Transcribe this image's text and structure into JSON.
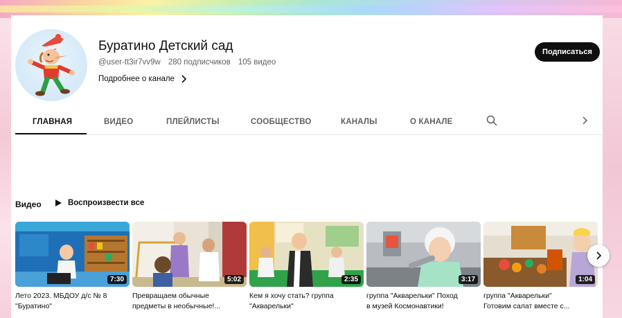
{
  "channel": {
    "name": "Буратино Детский сад",
    "handle": "@user-tt3ir7vv9w",
    "subscribers": "280 подписчиков",
    "videos_count": "105 видео",
    "more_link": "Подробнее о канале",
    "subscribe_label": "Подписаться"
  },
  "tabs": [
    {
      "label": "ГЛАВНАЯ"
    },
    {
      "label": "ВИДЕО"
    },
    {
      "label": "ПЛЕЙЛИСТЫ"
    },
    {
      "label": "СООБЩЕСТВО"
    },
    {
      "label": "КАНАЛЫ"
    },
    {
      "label": "О КАНАЛЕ"
    }
  ],
  "section": {
    "title": "Видео",
    "play_all": "Воспроизвести все"
  },
  "videos": [
    {
      "duration": "7:30",
      "title_line1": "Лето 2023. МБДОУ д/с № 8",
      "title_line2": "\"Буратино\""
    },
    {
      "duration": "5:02",
      "title_line1": "Превращаем обычные",
      "title_line2": "предметы в необычные!..."
    },
    {
      "duration": "2:35",
      "title_line1": "Кем я хочу стать? группа",
      "title_line2": "\"Акварельки\""
    },
    {
      "duration": "3:17",
      "title_line1": "группа \"Акварельки\" Поход",
      "title_line2": "в музей Космонавтики!"
    },
    {
      "duration": "1:04",
      "title_line1": "группа \"Акварельки\"",
      "title_line2": "Готовим салат вместе с..."
    }
  ],
  "icons": {
    "search": "search-icon",
    "tabs_next": "chevron-right-icon",
    "more": "chevron-right-icon",
    "play": "play-icon",
    "carousel_next": "chevron-right-icon"
  },
  "colors": {
    "subscribe_bg": "#0f0f0f",
    "text_primary": "#0f0f0f",
    "text_secondary": "#606060"
  }
}
